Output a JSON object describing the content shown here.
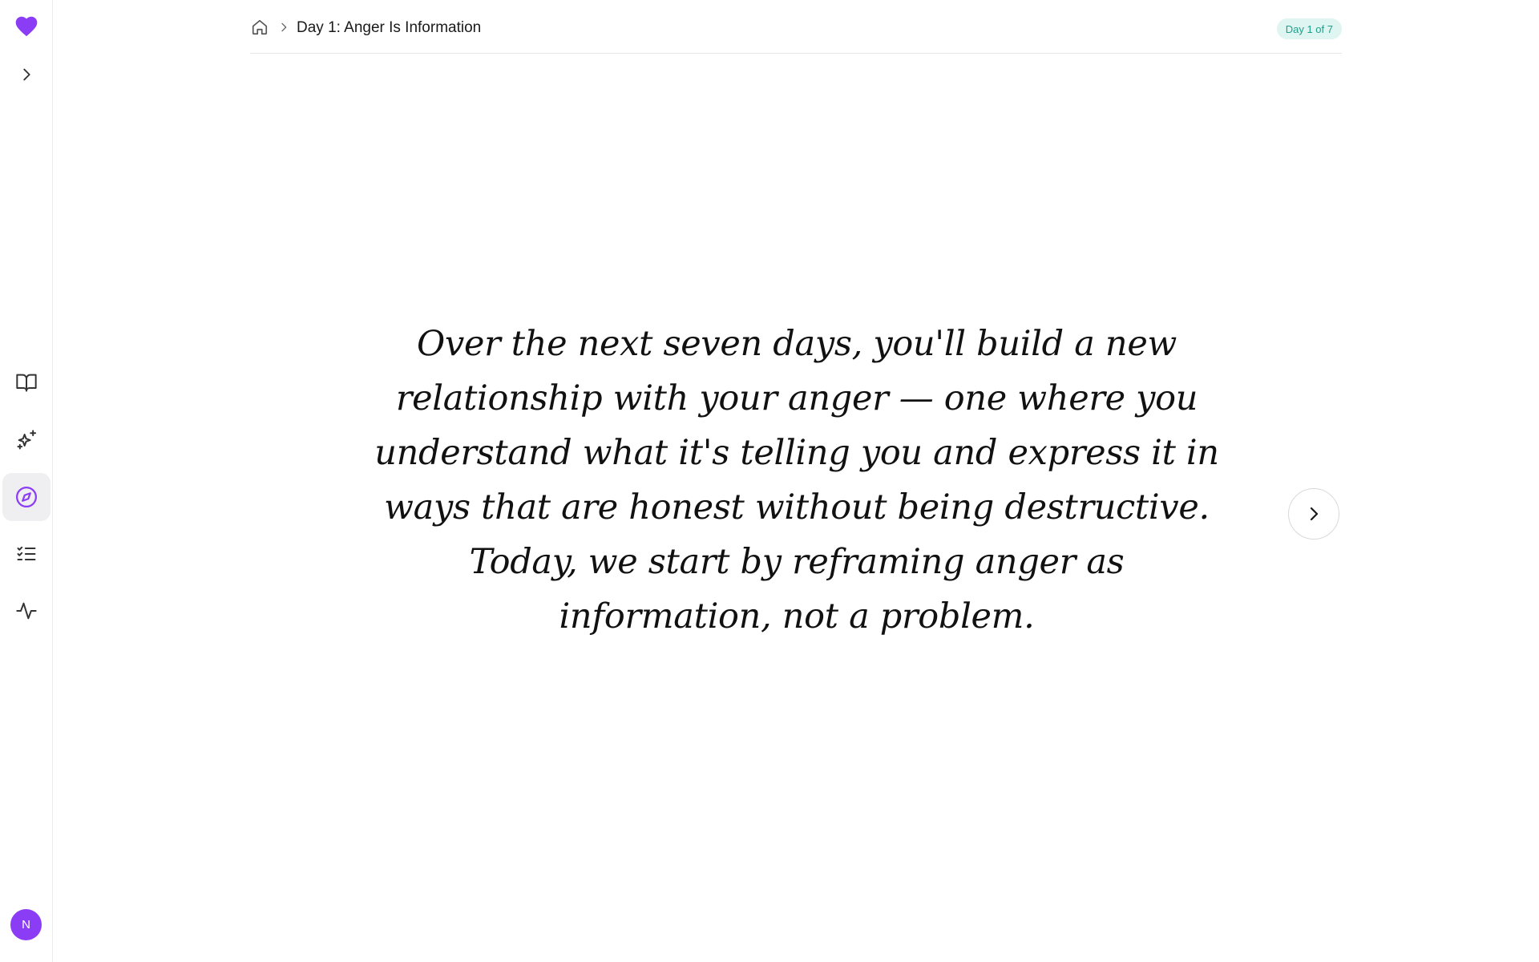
{
  "sidebar": {
    "logo_icon": "heart-icon",
    "expand_icon": "chevron-right-icon",
    "items": [
      {
        "name": "library",
        "icon": "book-open-icon",
        "active": false
      },
      {
        "name": "ai",
        "icon": "sparkles-icon",
        "active": false
      },
      {
        "name": "explore",
        "icon": "compass-icon",
        "active": true
      },
      {
        "name": "tasks",
        "icon": "list-checks-icon",
        "active": false
      },
      {
        "name": "activity",
        "icon": "activity-icon",
        "active": false
      }
    ],
    "avatar_initial": "N"
  },
  "breadcrumb": {
    "home_icon": "home-icon",
    "separator_icon": "chevron-right-icon",
    "title": "Day 1: Anger Is Information"
  },
  "badge": {
    "text": "Day 1 of 7"
  },
  "content": {
    "body": "Over the next seven days, you'll build a new relationship with your anger — one where you understand what it's telling you and express it in ways that are honest without being destructive. Today, we start by reframing anger as information, not a problem."
  },
  "next_button": {
    "icon": "chevron-right-icon"
  },
  "colors": {
    "brand": "#8b3df5",
    "badge_bg": "#dff5f1",
    "badge_text": "#1f9e8a",
    "active_nav_bg": "#efeff2"
  }
}
